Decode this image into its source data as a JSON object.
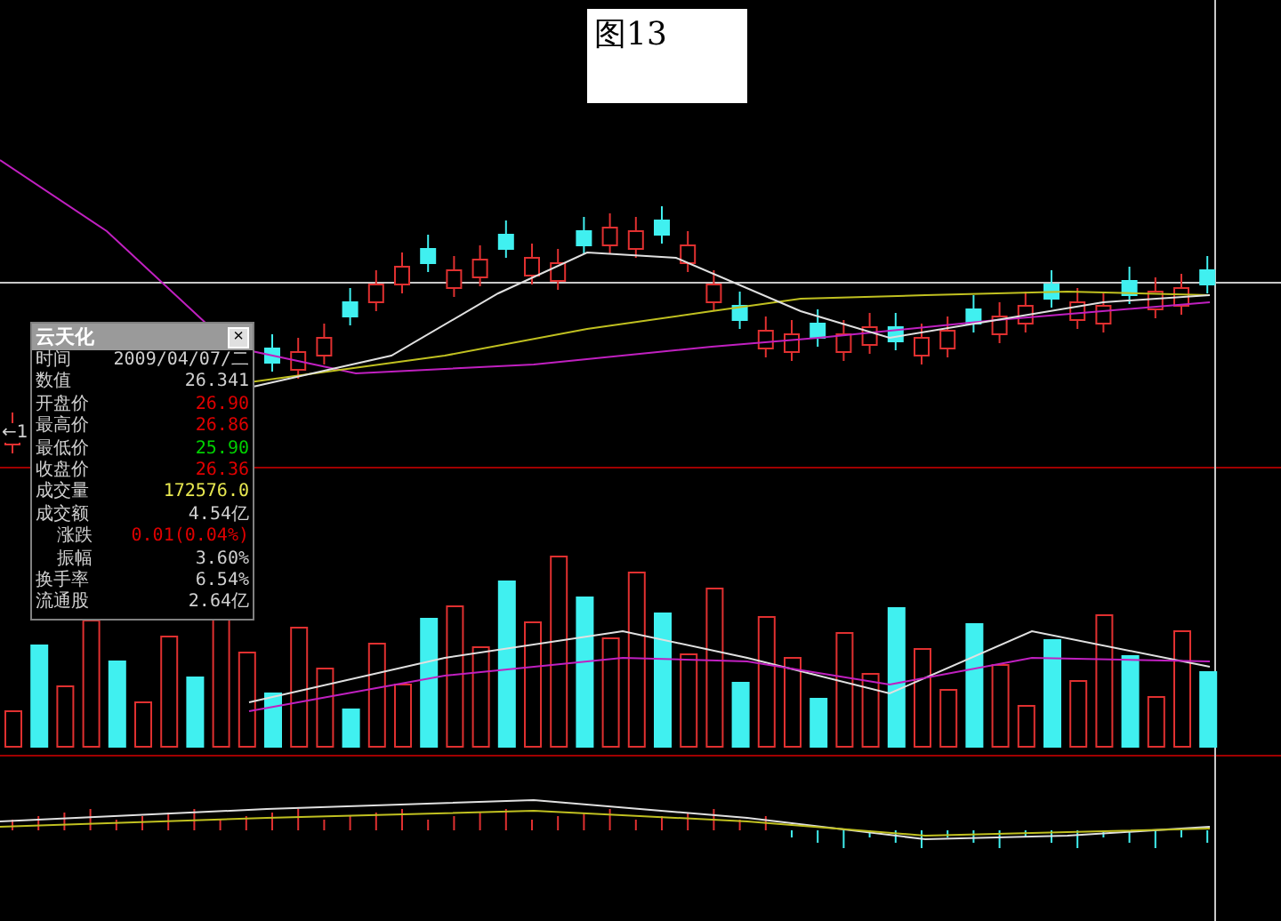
{
  "caption": "图13",
  "side_marker": "←1",
  "info_panel": {
    "title": "云天化",
    "close": "×",
    "rows": [
      {
        "label": "时间",
        "value": "2009/04/07/二",
        "color": "#d0d0d0",
        "indented": false
      },
      {
        "label": "数值",
        "value": "26.341",
        "color": "#d0d0d0",
        "indented": false
      },
      {
        "label": "开盘价",
        "value": "26.90",
        "color": "#e00000",
        "indented": false
      },
      {
        "label": "最高价",
        "value": "26.86",
        "color": "#e00000",
        "indented": false
      },
      {
        "label": "最低价",
        "value": "25.90",
        "color": "#00d000",
        "indented": false
      },
      {
        "label": "收盘价",
        "value": "26.36",
        "color": "#e00000",
        "indented": false
      },
      {
        "label": "成交量",
        "value": "172576.0",
        "color": "#e8e850",
        "indented": false
      },
      {
        "label": "成交额",
        "value": "4.54亿",
        "color": "#d0d0d0",
        "indented": false
      },
      {
        "label": "涨跌",
        "value": "0.01(0.04%)",
        "color": "#e00000",
        "indented": true
      },
      {
        "label": "振幅",
        "value": "3.60%",
        "color": "#d0d0d0",
        "indented": true
      },
      {
        "label": "换手率",
        "value": "6.54%",
        "color": "#d0d0d0",
        "indented": false
      },
      {
        "label": "流通股",
        "value": "2.64亿",
        "color": "#d0d0d0",
        "indented": false
      }
    ]
  }
}
